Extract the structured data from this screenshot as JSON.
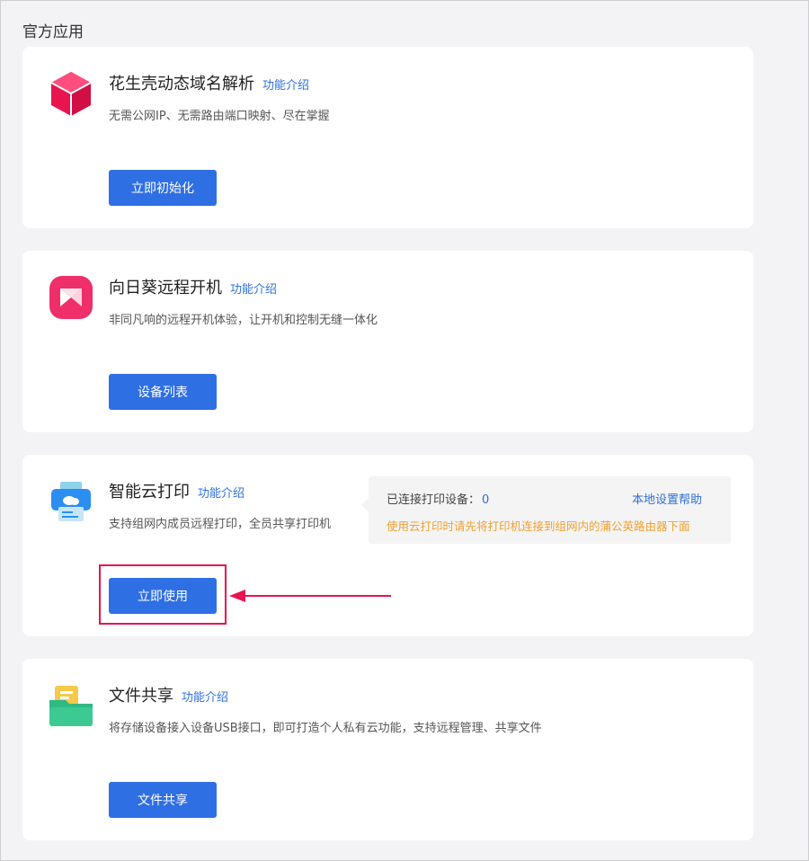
{
  "section_title": "官方应用",
  "intro_label": "功能介绍",
  "apps": [
    {
      "name": "花生壳动态域名解析",
      "desc": "无需公网IP、无需路由端口映射、尽在掌握",
      "button": "立即初始化",
      "icon": "peanut-shell-cube-icon"
    },
    {
      "name": "向日葵远程开机",
      "desc": "非同凡响的远程开机体验，让开机和控制无缝一体化",
      "button": "设备列表",
      "icon": "sunflower-remote-icon"
    },
    {
      "name": "智能云打印",
      "desc": "支持组网内成员远程打印，全员共享打印机",
      "button": "立即使用",
      "icon": "cloud-printer-icon",
      "info": {
        "connected_label": "已连接打印设备：",
        "connected_count": "0",
        "help_link": "本地设置帮助",
        "warning": "使用云打印时请先将打印机连接到组网内的蒲公英路由器下面"
      }
    },
    {
      "name": "文件共享",
      "desc": "将存储设备接入设备USB接口，即可打造个人私有云功能，支持远程管理、共享文件",
      "button": "文件共享",
      "icon": "folder-share-icon"
    }
  ],
  "colors": {
    "primary": "#2f6fe4",
    "link": "#2f6fde",
    "warning": "#f0a030",
    "highlight": "#e8134f"
  }
}
